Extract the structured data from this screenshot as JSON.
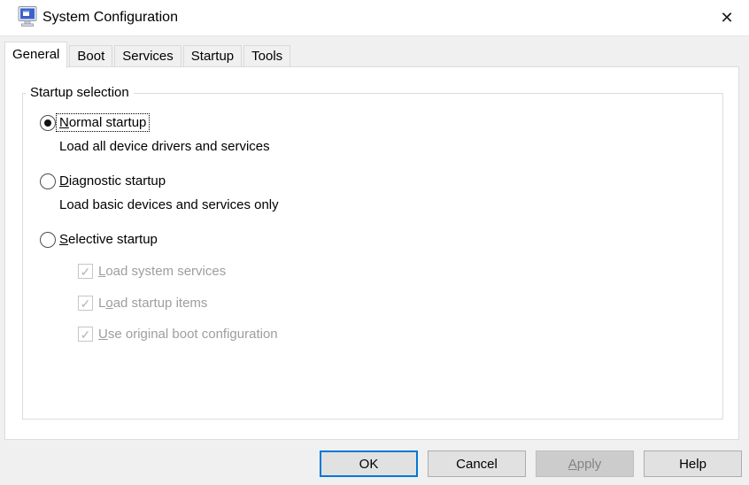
{
  "window": {
    "title": "System Configuration"
  },
  "icons": {
    "app": "msconfig-monitor",
    "close": "✕",
    "checkmark": "✓"
  },
  "colors": {
    "accent": "#0078d7",
    "titlebar_bg": "#ffffff",
    "dialog_bg": "#f0f0f0",
    "panel_bg": "#ffffff",
    "panel_border": "#dcdcdc",
    "button_bg": "#e1e1e1",
    "button_border": "#adadad",
    "disabled_button_bg": "#cccccc",
    "disabled_button_text": "#838383",
    "grayed_label": "#9e9e9e"
  },
  "tabs": [
    {
      "label": "General",
      "active": true
    },
    {
      "label": "Boot",
      "active": false
    },
    {
      "label": "Services",
      "active": false
    },
    {
      "label": "Startup",
      "active": false
    },
    {
      "label": "Tools",
      "active": false
    }
  ],
  "general": {
    "group_title": "Startup selection",
    "radios": [
      {
        "label": "Normal startup",
        "accel": 0,
        "selected": true,
        "focused": true,
        "description": "Load all device drivers and services"
      },
      {
        "label": "Diagnostic startup",
        "accel": 0,
        "selected": false,
        "description": "Load basic devices and services only"
      },
      {
        "label": "Selective startup",
        "accel": 0,
        "selected": false
      }
    ],
    "checkboxes": [
      {
        "label": "Load system services",
        "accel": 0,
        "checked": true,
        "disabled": true
      },
      {
        "label": "Load startup items",
        "accel": 1,
        "checked": true,
        "disabled": true
      },
      {
        "label": "Use original boot configuration",
        "accel": 0,
        "checked": true,
        "disabled": true
      }
    ]
  },
  "buttons": [
    {
      "label": "OK",
      "default": true,
      "disabled": false
    },
    {
      "label": "Cancel",
      "default": false,
      "disabled": false
    },
    {
      "label": "Apply",
      "accel": 0,
      "default": false,
      "disabled": true
    },
    {
      "label": "Help",
      "default": false,
      "disabled": false
    }
  ]
}
